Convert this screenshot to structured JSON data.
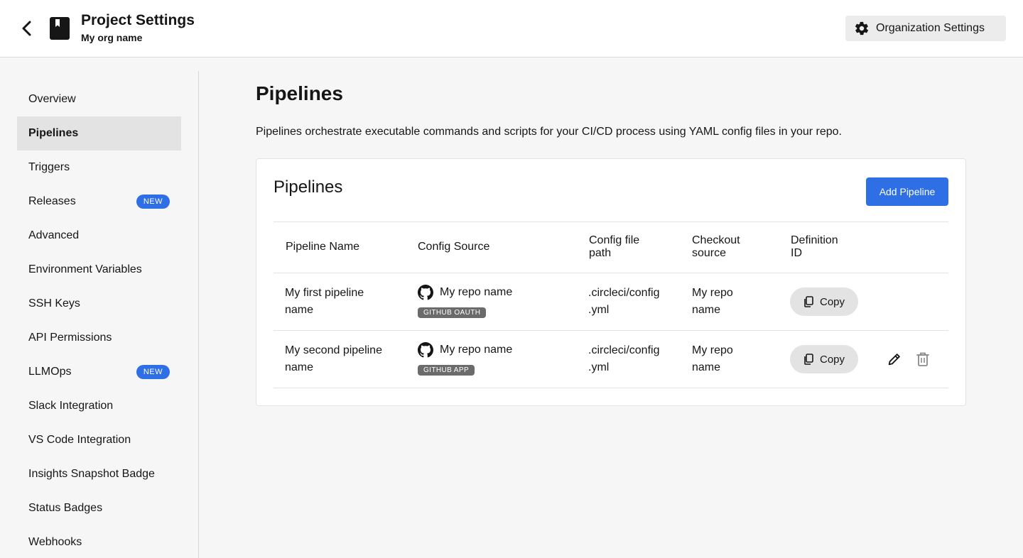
{
  "header": {
    "project_title": "Project Settings",
    "org_name": "My org name",
    "org_settings_label": "Organization Settings"
  },
  "sidebar": {
    "items": [
      {
        "label": "Overview",
        "active": false,
        "badge": ""
      },
      {
        "label": "Pipelines",
        "active": true,
        "badge": ""
      },
      {
        "label": "Triggers",
        "active": false,
        "badge": ""
      },
      {
        "label": "Releases",
        "active": false,
        "badge": "NEW"
      },
      {
        "label": "Advanced",
        "active": false,
        "badge": ""
      },
      {
        "label": "Environment Variables",
        "active": false,
        "badge": ""
      },
      {
        "label": "SSH Keys",
        "active": false,
        "badge": ""
      },
      {
        "label": "API Permissions",
        "active": false,
        "badge": ""
      },
      {
        "label": "LLMOps",
        "active": false,
        "badge": "NEW"
      },
      {
        "label": "Slack Integration",
        "active": false,
        "badge": ""
      },
      {
        "label": "VS Code Integration",
        "active": false,
        "badge": ""
      },
      {
        "label": "Insights Snapshot Badge",
        "active": false,
        "badge": ""
      },
      {
        "label": "Status Badges",
        "active": false,
        "badge": ""
      },
      {
        "label": "Webhooks",
        "active": false,
        "badge": ""
      }
    ]
  },
  "main": {
    "title": "Pipelines",
    "description": "Pipelines orchestrate executable commands and scripts for your CI/CD process using YAML config files in your repo.",
    "card": {
      "title": "Pipelines",
      "add_button_label": "Add Pipeline",
      "columns": {
        "name": "Pipeline Name",
        "config_source": "Config Source",
        "config_path_1": "Config file",
        "config_path_2": "path",
        "checkout_1": "Checkout",
        "checkout_2": "source",
        "definition_1": "Definition",
        "definition_2": "ID"
      },
      "rows": [
        {
          "name_1": "My first pipeline",
          "name_2": "name",
          "repo": "My repo name",
          "source_tag": "GITHUB OAUTH",
          "path_1": ".circleci/config",
          "path_2": ".yml",
          "checkout_1": "My repo",
          "checkout_2": "name",
          "copy_label": "Copy"
        },
        {
          "name_1": "My second pipeline",
          "name_2": "name",
          "repo": "My repo name",
          "source_tag": "GITHUB APP",
          "path_1": ".circleci/config",
          "path_2": ".yml",
          "checkout_1": "My repo",
          "checkout_2": "name",
          "copy_label": "Copy"
        }
      ]
    }
  },
  "icons": {
    "back": "chevron-left-icon",
    "project": "book-icon",
    "settings": "gear-icon",
    "github": "github-icon",
    "copy": "copy-icon",
    "edit": "pencil-icon",
    "delete": "trash-icon"
  },
  "colors": {
    "accent": "#2e6fe5",
    "tag": "#6b6b6b",
    "active_nav": "#e3e3e3"
  }
}
